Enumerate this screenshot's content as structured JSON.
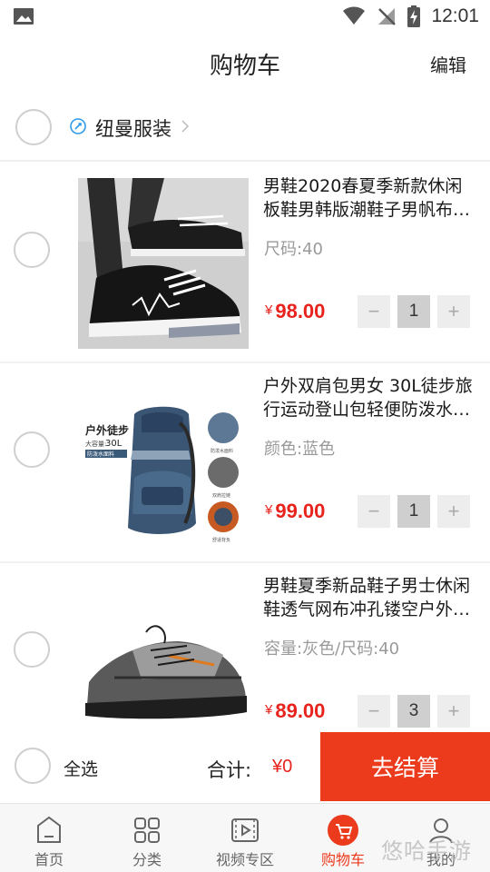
{
  "status_bar": {
    "time": "12:01"
  },
  "header": {
    "title": "购物车",
    "edit_label": "编辑"
  },
  "store": {
    "name": "纽曼服装"
  },
  "items": [
    {
      "title_line1": "男鞋2020春夏季新款休闲",
      "title_line2": "板鞋男韩版潮鞋子男帆布…",
      "spec": "尺码:40",
      "currency": "¥",
      "price": "98.00",
      "quantity": "1",
      "minus": "−",
      "plus": "+"
    },
    {
      "title_line1": "户外双肩包男女 30L徒步旅",
      "title_line2": "行运动登山包轻便防泼水…",
      "spec": "颜色:蓝色",
      "currency": "¥",
      "price": "99.00",
      "quantity": "1",
      "minus": "−",
      "plus": "+",
      "image_text": {
        "headline": "户外徒步",
        "capacity_label": "大容量:",
        "capacity": "30L",
        "tag": "防泼水面料",
        "feat1": "防泼水面料",
        "feat2": "双肩拉链",
        "feat3": "舒适背负"
      }
    },
    {
      "title_line1": "男鞋夏季新品鞋子男士休闲",
      "title_line2": "鞋透气网布冲孔镂空户外…",
      "spec": "容量:灰色/尺码:40",
      "currency": "¥",
      "price": "89.00",
      "quantity": "3",
      "minus": "−",
      "plus": "+"
    }
  ],
  "checkout": {
    "select_all_label": "全选",
    "total_label": "合计:",
    "total_value": "¥0",
    "button_label": "去结算"
  },
  "tabs": [
    {
      "label": "首页",
      "icon": "home-icon"
    },
    {
      "label": "分类",
      "icon": "category-grid-icon"
    },
    {
      "label": "视频专区",
      "icon": "video-icon"
    },
    {
      "label": "购物车",
      "icon": "cart-icon"
    },
    {
      "label": "我的",
      "icon": "user-icon"
    }
  ],
  "watermark": "悠哈手游",
  "colors": {
    "accent": "#ec3a1d",
    "price": "#e8221c",
    "store_icon": "#2f9ae8"
  }
}
